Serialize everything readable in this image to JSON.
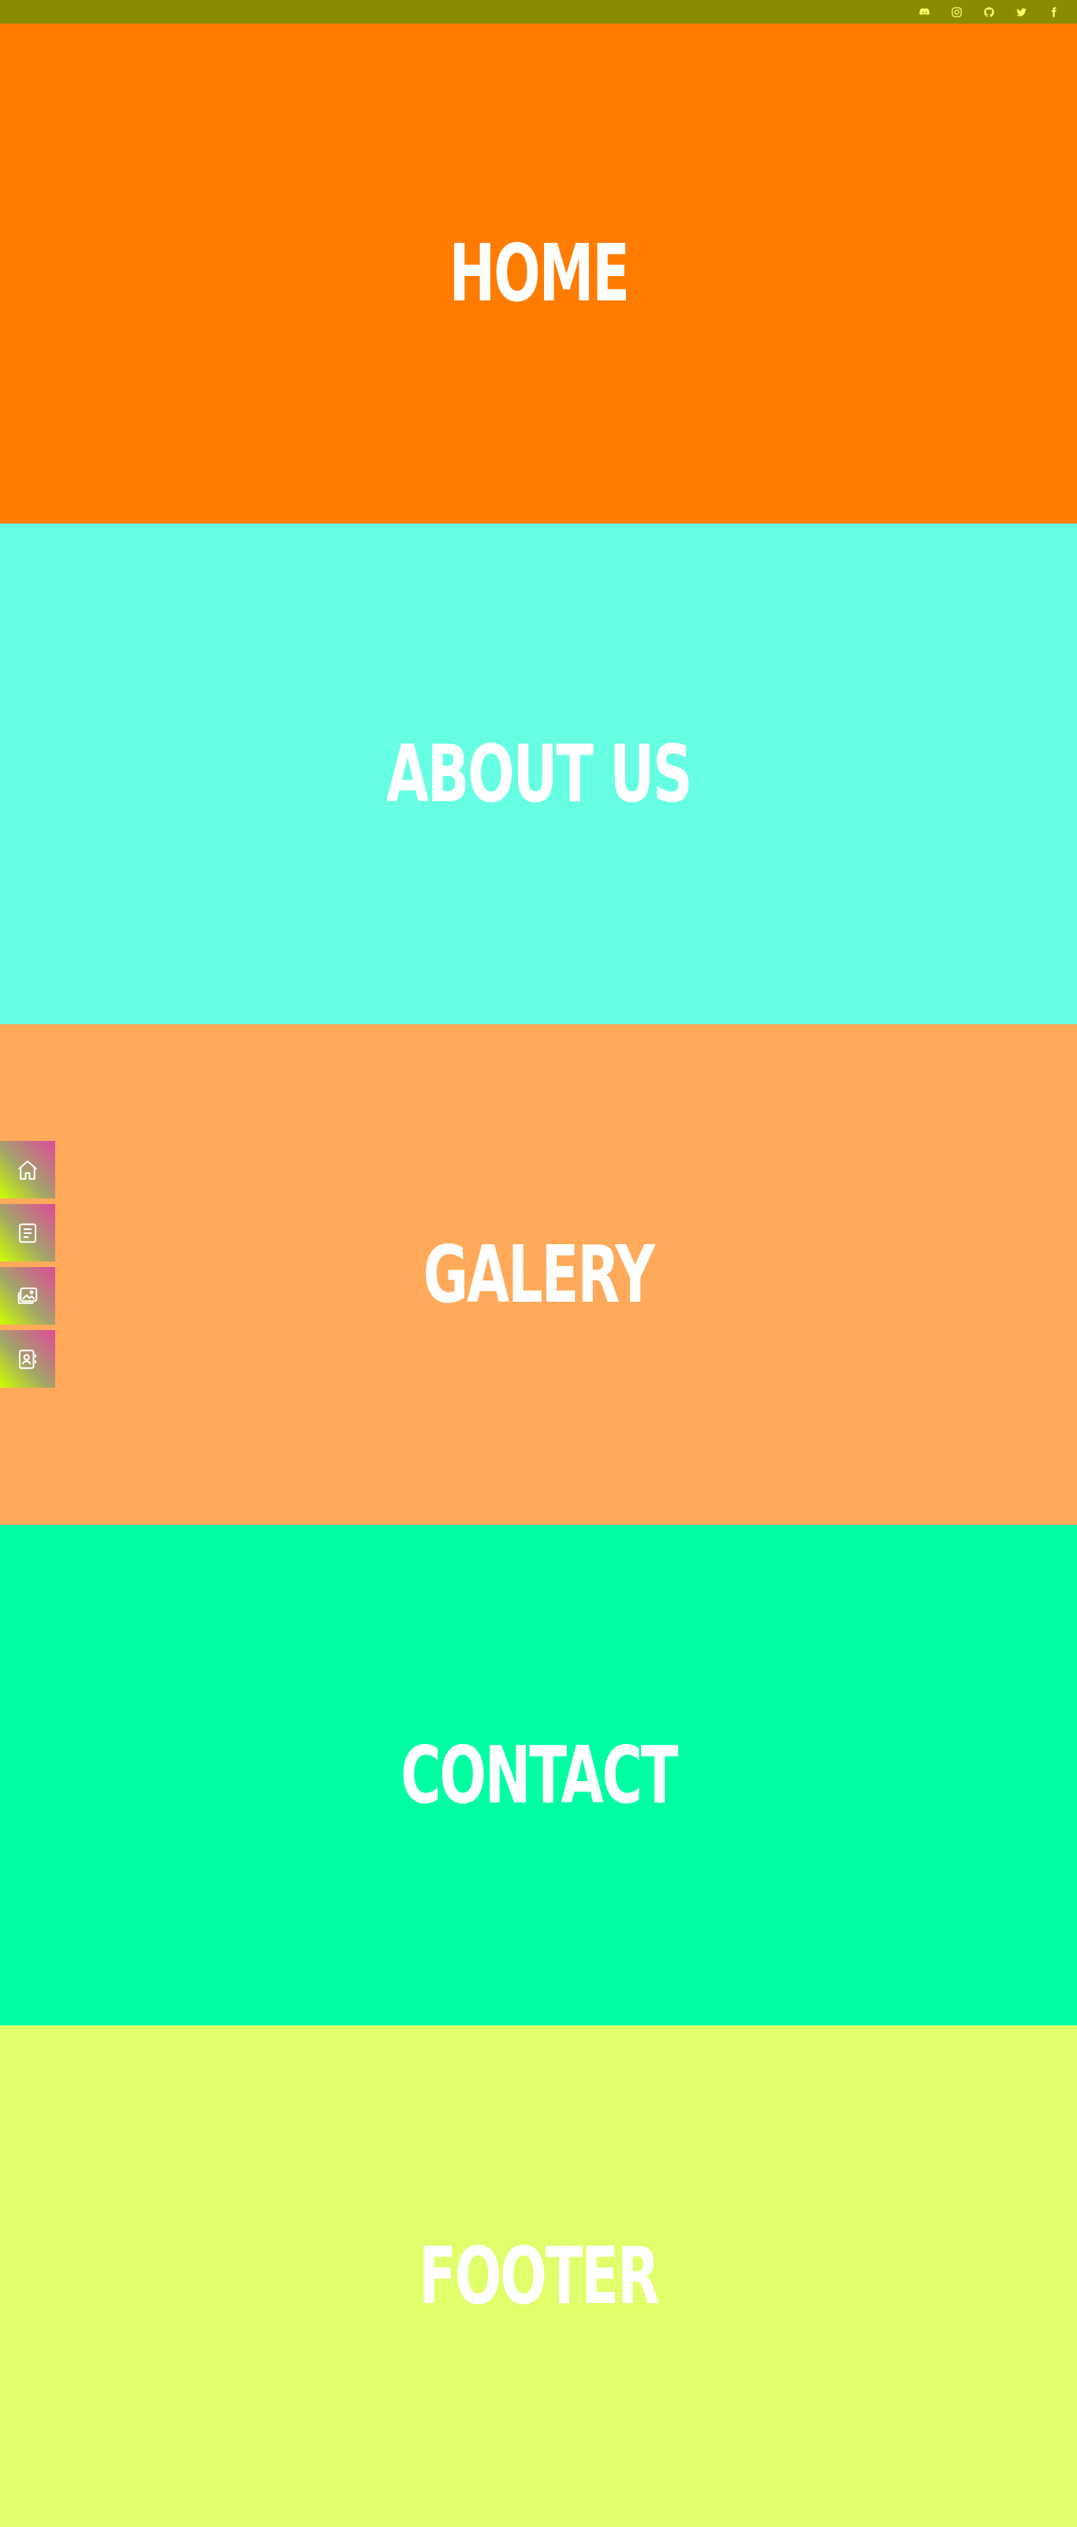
{
  "topbar": {
    "background": "#8b8b00",
    "icon_color": "#ffff66",
    "social_icons": [
      "discord-icon",
      "instagram-icon",
      "github-icon",
      "twitter-icon",
      "facebook-icon"
    ]
  },
  "sections": {
    "home": {
      "title": "HOME",
      "color": "#ff7c00"
    },
    "about": {
      "title": "ABOUT US",
      "color": "#66ffe3"
    },
    "galery": {
      "title": "GALERY",
      "color": "#ffaa5a"
    },
    "contact": {
      "title": "CONTACT",
      "color": "#00ffa3"
    },
    "footer": {
      "title": "FOOTER",
      "color": "#e0ff6a"
    }
  },
  "sidenav": {
    "items": [
      "home-icon",
      "document-icon",
      "gallery-icon",
      "contact-card-icon"
    ]
  }
}
